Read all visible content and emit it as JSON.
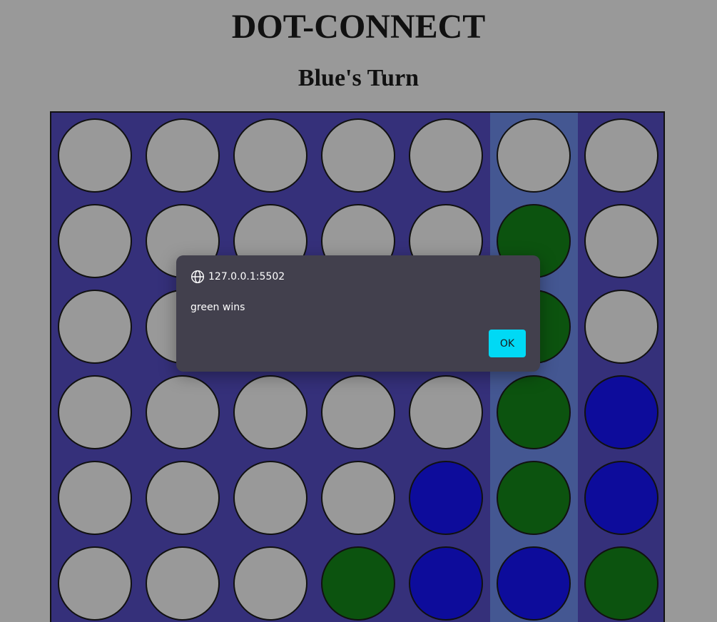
{
  "page": {
    "title": "DOT-CONNECT",
    "turn_text": "Blue's Turn"
  },
  "board": {
    "rows": 6,
    "columns": 7,
    "hover_column": 5,
    "colors": {
      "empty": "#999999",
      "green": "#0c530f",
      "blue": "#0d0c9b",
      "board": "#35307a",
      "hover_column": "#445792"
    },
    "cells": [
      [
        "empty",
        "empty",
        "empty",
        "empty",
        "empty",
        "empty",
        "empty"
      ],
      [
        "empty",
        "empty",
        "empty",
        "empty",
        "empty",
        "green",
        "empty"
      ],
      [
        "empty",
        "empty",
        "empty",
        "empty",
        "empty",
        "green",
        "empty"
      ],
      [
        "empty",
        "empty",
        "empty",
        "empty",
        "empty",
        "green",
        "blue"
      ],
      [
        "empty",
        "empty",
        "empty",
        "empty",
        "blue",
        "green",
        "blue"
      ],
      [
        "empty",
        "empty",
        "empty",
        "green",
        "blue",
        "blue",
        "green"
      ]
    ]
  },
  "dialog": {
    "origin": "127.0.0.1:5502",
    "origin_icon": "globe-icon",
    "message": "green wins",
    "ok_label": "OK",
    "ok_color": "#00d9f5"
  }
}
